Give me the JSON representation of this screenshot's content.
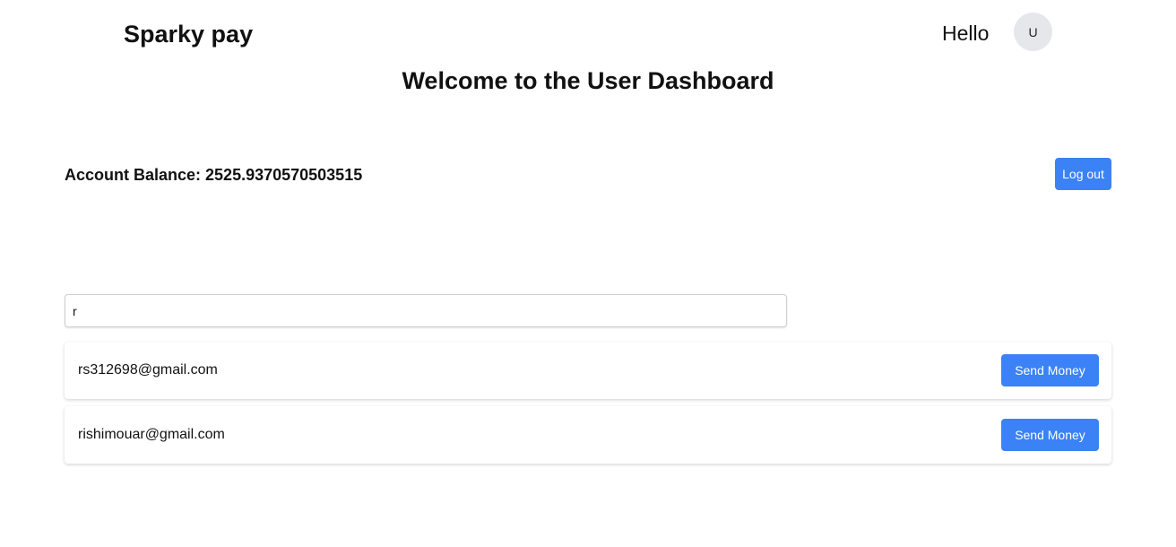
{
  "header": {
    "brand": "Sparky pay",
    "greeting": "Hello",
    "avatar_initial": "U"
  },
  "main": {
    "title": "Welcome to the User Dashboard",
    "balance_label": "Account Balance: 2525.9370570503515",
    "logout_label": "Log out",
    "search": {
      "value": "r",
      "placeholder": ""
    },
    "users": [
      {
        "email": "rs312698@gmail.com",
        "action": "Send Money"
      },
      {
        "email": "rishimouar@gmail.com",
        "action": "Send Money"
      }
    ]
  },
  "colors": {
    "accent": "#3b82f6",
    "avatar_bg": "#e5e7eb"
  }
}
